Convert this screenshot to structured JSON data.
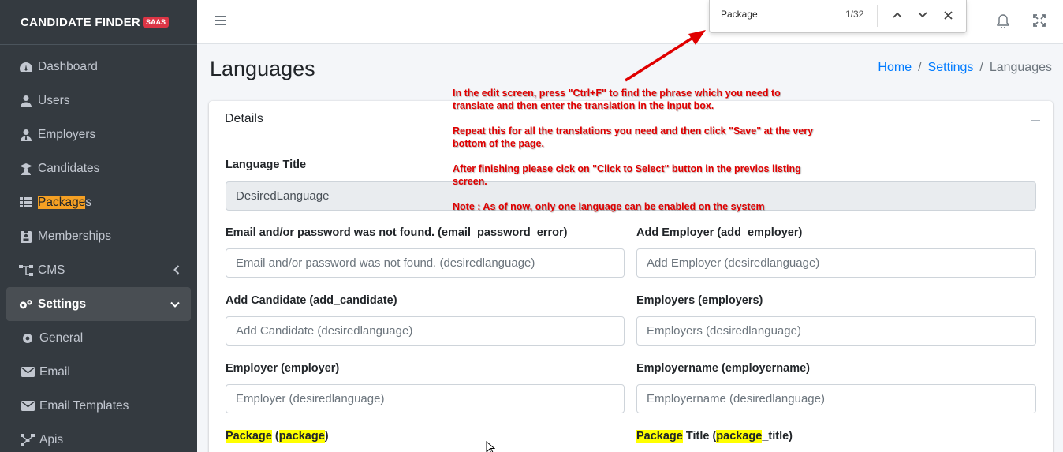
{
  "brand": {
    "logo_text": "CANDIDATE FINDER",
    "badge": "SAAS"
  },
  "sidebar": {
    "items": [
      {
        "label": "Dashboard",
        "icon": "tachometer-icon"
      },
      {
        "label": "Users",
        "icon": "user-icon"
      },
      {
        "label": "Employers",
        "icon": "user-tie-icon"
      },
      {
        "label": "Candidates",
        "icon": "graduation-cap-icon"
      },
      {
        "label_highlight": "Package",
        "label_rest": "s",
        "icon": "list-icon"
      },
      {
        "label": "Memberships",
        "icon": "id-badge-icon"
      },
      {
        "label": "CMS",
        "icon": "sitemap-icon"
      },
      {
        "label": "Settings",
        "icon": "gears-icon"
      },
      {
        "label": "General",
        "icon": "gear-icon"
      },
      {
        "label": "Email",
        "icon": "envelope-icon"
      },
      {
        "label": "Email Templates",
        "icon": "envelope-icon"
      },
      {
        "label": "Apis",
        "icon": "network-icon"
      }
    ]
  },
  "findbar": {
    "query": "Package",
    "count": "1/32"
  },
  "page": {
    "title": "Languages"
  },
  "breadcrumb": {
    "home": "Home",
    "sep": "/",
    "settings": "Settings",
    "current": "Languages"
  },
  "card": {
    "header": "Details"
  },
  "form": {
    "language_title_label": "Language Title",
    "language_title_value": "DesiredLanguage",
    "fields": [
      {
        "label": "Email and/or password was not found. (email_password_error)",
        "placeholder": "Email and/or password was not found. (desiredlanguage)"
      },
      {
        "label": "Add Employer (add_employer)",
        "placeholder": "Add Employer (desiredlanguage)"
      },
      {
        "label": "Add Candidate (add_candidate)",
        "placeholder": "Add Candidate (desiredlanguage)"
      },
      {
        "label": "Employers (employers)",
        "placeholder": "Employers (desiredlanguage)"
      },
      {
        "label": "Employer (employer)",
        "placeholder": "Employer (desiredlanguage)"
      },
      {
        "label": "Employername (employername)",
        "placeholder": "Employername (desiredlanguage)"
      }
    ],
    "package_label": {
      "hl1": "Package",
      "mid1": " (",
      "hl2": "package",
      "end": ")"
    },
    "package_title_label": {
      "hl1": "Package",
      "mid1": " Title (",
      "hl2": "package",
      "end": "_title)"
    }
  },
  "annotation": {
    "lines": [
      "In the edit screen, press \"Ctrl+F\" to find the phrase which you need to translate and then enter the translation in the input box.",
      "Repeat this for all the translations you need and then click \"Save\" at the very bottom of the page.",
      "After finishing please cick on \"Click to Select\" button in the previos listing screen.",
      "Note : As of now, only one language can be enabled on the system"
    ]
  },
  "colors": {
    "sidebar_bg": "#343a40",
    "annotation_red": "#e00000",
    "link_blue": "#007bff",
    "find_highlight": "#ffff00",
    "active_highlight": "#f5a023"
  }
}
